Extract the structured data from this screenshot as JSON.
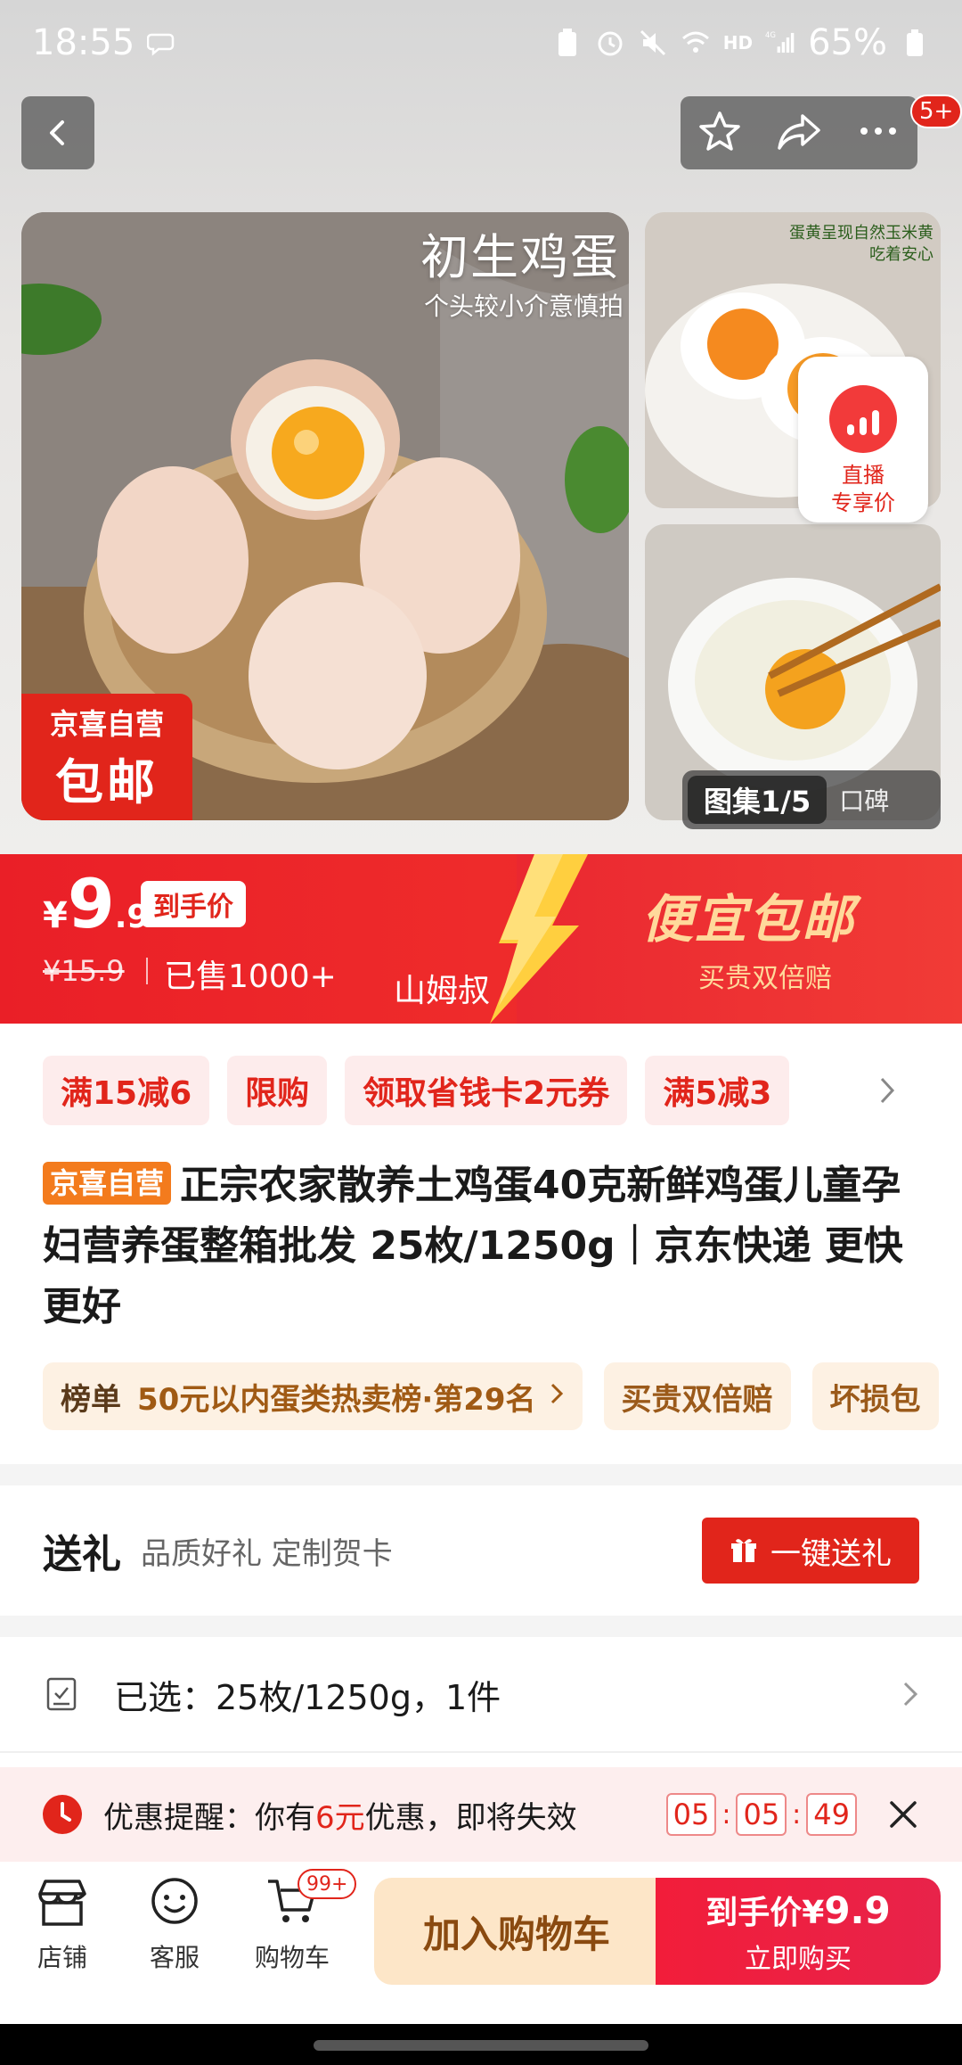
{
  "status_bar": {
    "time": "18:55",
    "network": "4G",
    "hd": "HD",
    "battery": "65%"
  },
  "header": {
    "badge": "5+"
  },
  "gallery": {
    "main_title": "初生鸡蛋",
    "main_subtitle": "个头较小介意慎拍",
    "badge_top": "京喜自营",
    "badge_bottom": "包邮",
    "side_top_text_1": "蛋黄呈现自然玉米黄",
    "side_top_text_2": "吃着安心",
    "live_label_1": "直播",
    "live_label_2": "专享价",
    "tab_active": "图集1/5",
    "tab_other": "口碑"
  },
  "price": {
    "currency": "¥",
    "integer": "9",
    "decimal": ".9",
    "tag": "到手价",
    "original": "¥15.9",
    "sold": "已售1000+",
    "watermark": "山姆叔",
    "promo_title": "便宜包邮",
    "promo_sub": "买贵双倍赔"
  },
  "coupons": [
    "满15减6",
    "限购",
    "领取省钱卡2元券",
    "满5减3"
  ],
  "product": {
    "tag": "京喜自营",
    "title": "正宗农家散养土鸡蛋40克新鲜鸡蛋儿童孕妇营养蛋整箱批发 25枚/1250g｜京东快递 更快更好"
  },
  "tags": {
    "rank_label": "榜单",
    "rank_text": "50元以内蛋类热卖榜·第29名",
    "tag1": "买贵双倍赔",
    "tag2": "坏损包"
  },
  "gift": {
    "label": "送礼",
    "sub": "品质好礼 定制贺卡",
    "button": "一键送礼"
  },
  "selection": {
    "text": "已选：25枚/1250g，1件"
  },
  "reminder": {
    "prefix": "优惠提醒：你有",
    "amount": "6元",
    "suffix": "优惠，即将失效",
    "hours": "05",
    "minutes": "05",
    "seconds": "49"
  },
  "bottom_bar": {
    "store": "店铺",
    "service": "客服",
    "cart": "购物车",
    "cart_badge": "99+",
    "add_cart": "加入购物车",
    "buy_prefix": "到手价¥",
    "buy_price": "9.9",
    "buy_now": "立即购买"
  },
  "colors": {
    "brand_red": "#e1251b",
    "promo_gold": "#ffd99b",
    "tag_orange": "#f37b1d"
  }
}
